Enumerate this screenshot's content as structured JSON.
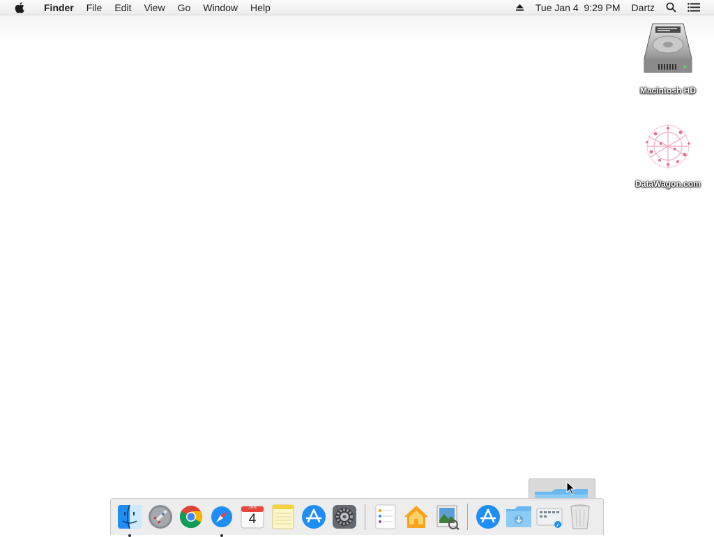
{
  "menubar": {
    "app_name": "Finder",
    "items": [
      "File",
      "Edit",
      "View",
      "Go",
      "Window",
      "Help"
    ],
    "clock": "Tue Jan 4  9:29 PM",
    "user": "Dartz"
  },
  "desktop": {
    "icons": [
      {
        "label": "Macintosh HD",
        "icon": "hard-drive-icon"
      },
      {
        "label": "DataWagon.com",
        "icon": "network-volume-icon"
      }
    ]
  },
  "dock": {
    "apps": [
      {
        "name": "finder",
        "running": true
      },
      {
        "name": "launchpad",
        "running": false
      },
      {
        "name": "chrome",
        "running": false
      },
      {
        "name": "safari",
        "running": true
      },
      {
        "name": "calendar",
        "running": false,
        "month": "JAN",
        "day": "4"
      },
      {
        "name": "notes",
        "running": false
      },
      {
        "name": "app-store",
        "running": false
      },
      {
        "name": "system-preferences",
        "running": false
      },
      {
        "name": "reminders",
        "running": false
      },
      {
        "name": "home",
        "running": false
      },
      {
        "name": "preview",
        "running": false
      }
    ],
    "stacks": [
      "applications-stack",
      "downloads-stack",
      "documents-stack",
      "trash"
    ]
  },
  "colors": {
    "desktop_bg": "#ffffff",
    "menubar_bg": "#ececec",
    "accent_blue": "#1e8ef5"
  }
}
